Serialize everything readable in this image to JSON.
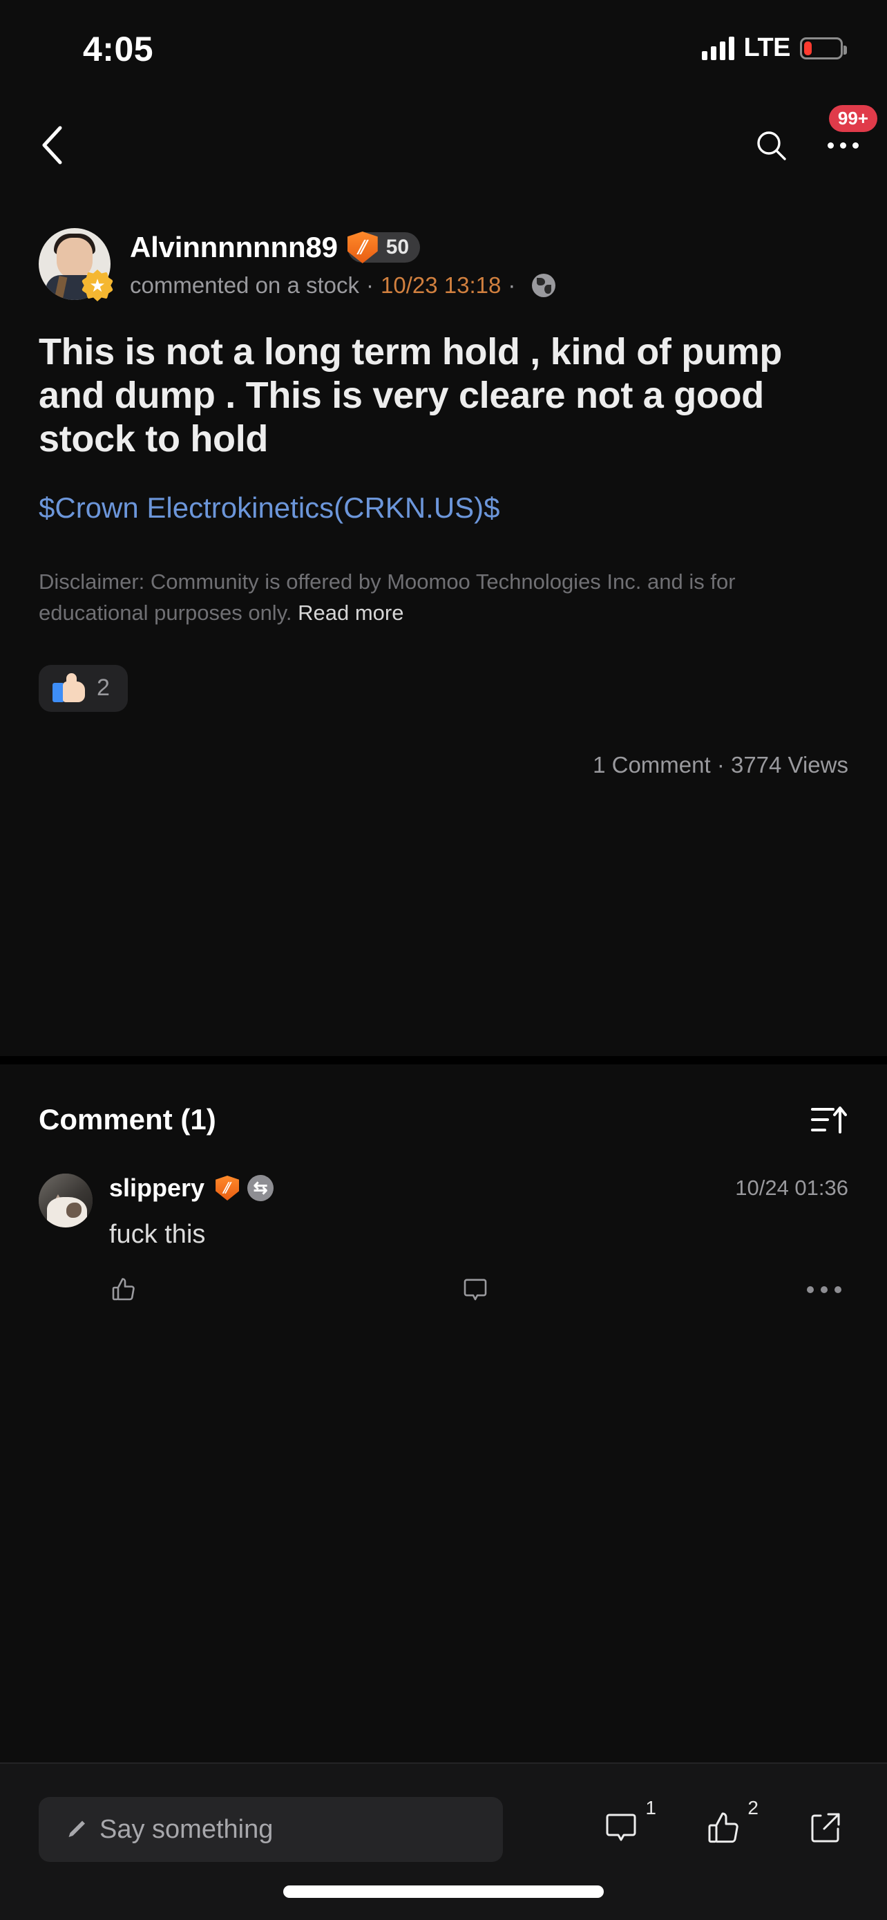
{
  "status_bar": {
    "time": "4:05",
    "network": "LTE",
    "signal_icon": "signal-bars-icon",
    "battery_icon": "battery-low-icon",
    "battery_color": "#ff3b30"
  },
  "nav_bar": {
    "back_icon": "chevron-left-icon",
    "search_icon": "search-icon",
    "more_icon": "more-horizontal-icon",
    "notification_badge": "99+",
    "badge_color": "#e03b4a"
  },
  "post": {
    "author": {
      "name": "Alvinnnnnnn89",
      "avatar_icon": "user-avatar",
      "avatar_star_icon": "star-badge-icon",
      "shield_icon": "moomoo-shield-icon",
      "shield_glyph": "⫽",
      "level": "50"
    },
    "action": "commented on a stock",
    "separator": "·",
    "timestamp": "10/23 13:18",
    "timestamp_color": "#d1803f",
    "visibility_icon": "globe-public-icon",
    "body": "This is not a long term hold , kind of pump and dump . This is very cleare not a good stock to hold",
    "stock_link": "$Crown Electrokinetics(CRKN.US)$",
    "stock_link_color": "#6c96da",
    "disclaimer": "Disclaimer: Community is offered by Moomoo Technologies Inc. and is for educational purposes only. ",
    "read_more": "Read more",
    "reaction": {
      "icon": "thumbs-up-emoji",
      "count": "2"
    },
    "stats": "1 Comment · 3774 Views"
  },
  "comments_section": {
    "title": "Comment (1)",
    "sort_icon": "sort-ascending-icon",
    "items": [
      {
        "avatar_icon": "cat-avatar",
        "name": "slippery",
        "shield_icon": "moomoo-shield-icon",
        "shield_glyph": "⫽",
        "second_badge_icon": "exchange-badge-icon",
        "second_badge_glyph": "⇆",
        "time": "10/24 01:36",
        "text": "fuck this",
        "actions": {
          "like_icon": "thumbs-up-outline-icon",
          "reply_icon": "comment-bubble-outline-icon",
          "more_icon": "more-horizontal-icon"
        }
      }
    ]
  },
  "bottom_bar": {
    "composer_icon": "pencil-icon",
    "composer_placeholder": "Say something",
    "comment_icon": "comment-bubble-icon",
    "comment_count": "1",
    "like_icon": "thumbs-up-icon",
    "like_count": "2",
    "share_icon": "share-icon",
    "home_indicator": "home-indicator"
  }
}
